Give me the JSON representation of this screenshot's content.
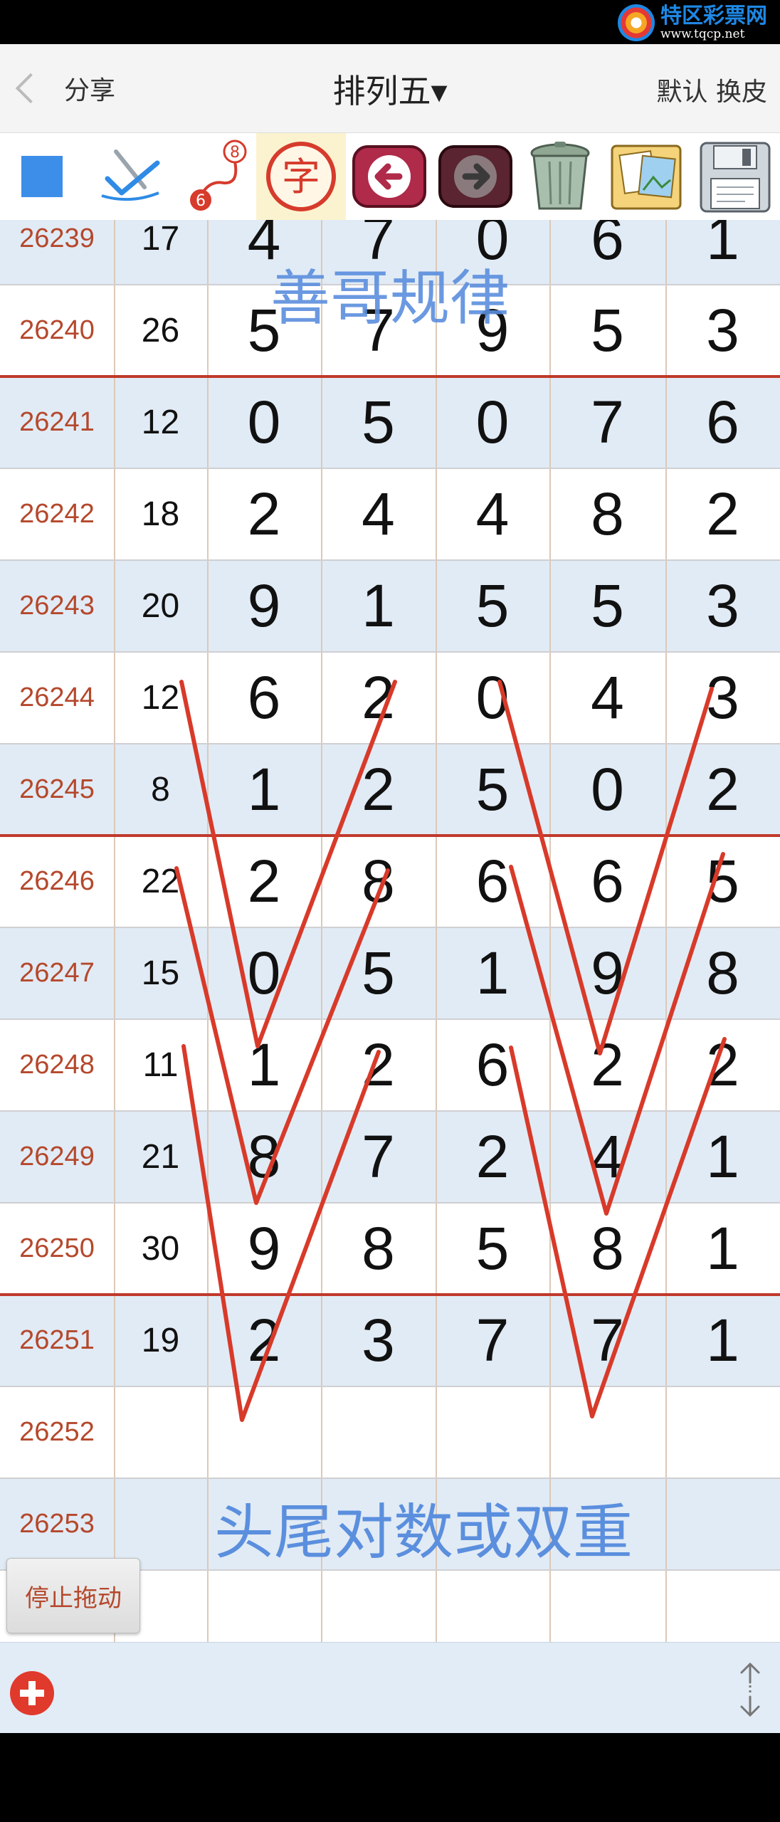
{
  "watermark": {
    "title": "特区彩票网",
    "url": "www.tqcp.net"
  },
  "header": {
    "back_label": "分享",
    "title": "排列五▾",
    "right_label": "默认 换皮"
  },
  "toolbar": {
    "items": [
      {
        "name": "blue-square-icon"
      },
      {
        "name": "pen-check-icon"
      },
      {
        "name": "route-icon",
        "top_number": "8",
        "bottom_number": "6"
      },
      {
        "name": "char-icon",
        "label": "字"
      },
      {
        "name": "back-arrow-icon"
      },
      {
        "name": "forward-arrow-icon"
      },
      {
        "name": "trash-icon"
      },
      {
        "name": "photos-icon"
      },
      {
        "name": "save-icon"
      }
    ]
  },
  "overlay": {
    "top_text": "善哥规律",
    "bottom_text": "头尾对数或双重"
  },
  "table": {
    "rows": [
      {
        "issue": "26239",
        "sum": "17",
        "digits": [
          "4",
          "7",
          "0",
          "6",
          "1"
        ]
      },
      {
        "issue": "26240",
        "sum": "26",
        "digits": [
          "5",
          "7",
          "9",
          "5",
          "3"
        ]
      },
      {
        "issue": "26241",
        "sum": "12",
        "digits": [
          "0",
          "5",
          "0",
          "7",
          "6"
        ]
      },
      {
        "issue": "26242",
        "sum": "18",
        "digits": [
          "2",
          "4",
          "4",
          "8",
          "2"
        ]
      },
      {
        "issue": "26243",
        "sum": "20",
        "digits": [
          "9",
          "1",
          "5",
          "5",
          "3"
        ]
      },
      {
        "issue": "26244",
        "sum": "12",
        "digits": [
          "6",
          "2",
          "0",
          "4",
          "3"
        ]
      },
      {
        "issue": "26245",
        "sum": "8",
        "digits": [
          "1",
          "2",
          "5",
          "0",
          "2"
        ]
      },
      {
        "issue": "26246",
        "sum": "22",
        "digits": [
          "2",
          "8",
          "6",
          "6",
          "5"
        ]
      },
      {
        "issue": "26247",
        "sum": "15",
        "digits": [
          "0",
          "5",
          "1",
          "9",
          "8"
        ]
      },
      {
        "issue": "26248",
        "sum": "11",
        "digits": [
          "1",
          "2",
          "6",
          "2",
          "2"
        ]
      },
      {
        "issue": "26249",
        "sum": "21",
        "digits": [
          "8",
          "7",
          "2",
          "4",
          "1"
        ]
      },
      {
        "issue": "26250",
        "sum": "30",
        "digits": [
          "9",
          "8",
          "5",
          "8",
          "1"
        ]
      },
      {
        "issue": "26251",
        "sum": "19",
        "digits": [
          "2",
          "3",
          "7",
          "7",
          "1"
        ]
      },
      {
        "issue": "26252",
        "sum": "",
        "digits": [
          "",
          "",
          "",
          "",
          ""
        ]
      },
      {
        "issue": "26253",
        "sum": "",
        "digits": [
          "",
          "",
          "",
          "",
          ""
        ]
      },
      {
        "issue": "",
        "sum": "",
        "digits": [
          "",
          "",
          "",
          "",
          ""
        ]
      }
    ]
  },
  "buttons": {
    "stop_drag": "停止拖动"
  },
  "bottom_bar": {
    "add_icon": "plus-circle-icon",
    "resize_icon": "resize-vertical-icon"
  },
  "colors": {
    "accent_red": "#c0392b",
    "issue_text": "#b5482c",
    "row_blue": "#e1ebf5",
    "overlay_blue": "#5b8fde"
  }
}
